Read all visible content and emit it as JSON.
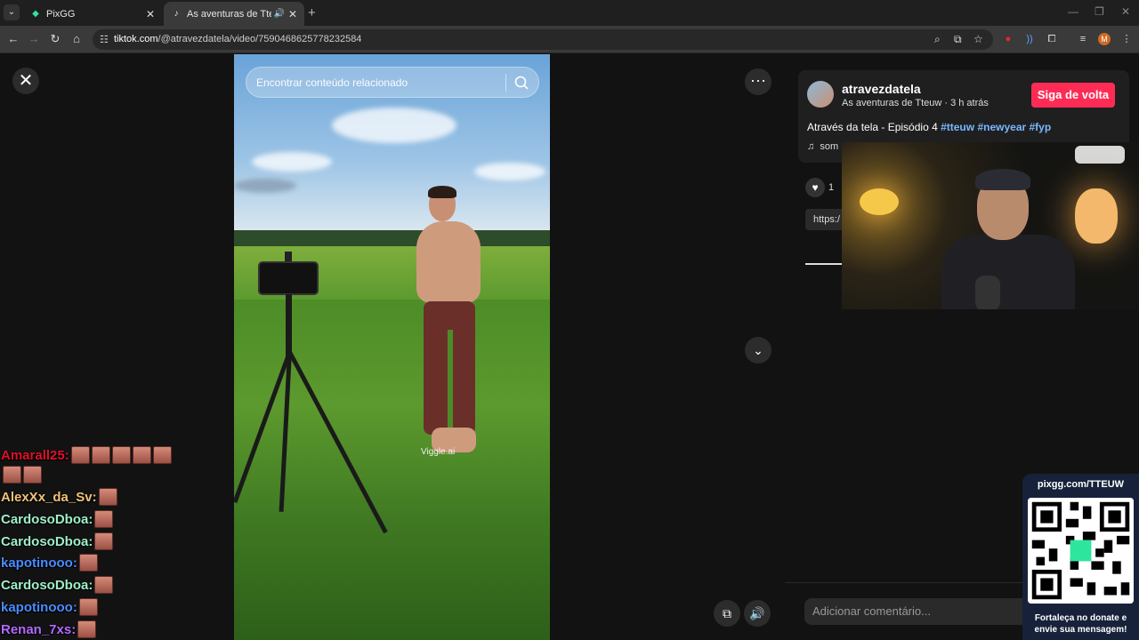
{
  "browser": {
    "tabs": [
      {
        "title": "PixGG",
        "active": false
      },
      {
        "title": "As aventuras de Tteuw (@a",
        "active": true
      }
    ],
    "url_host": "tiktok.com",
    "url_path": "/@atravezdatela/video/7590468625778232584",
    "profile_initial": "M"
  },
  "video": {
    "search_placeholder": "Encontrar conteúdo relacionado",
    "watermark": "Viggle.ai"
  },
  "post": {
    "author": "atravezdatela",
    "meta": "As aventuras de Tteuw · 3 h atrás",
    "follow_label": "Siga de volta",
    "caption_text": "Através da tela - Episódio 4 ",
    "hashtags": [
      "#tteuw",
      "#newyear",
      "#fyp"
    ],
    "sound_label": "som",
    "like_count": "1",
    "link_preview": "https:/",
    "comment_placeholder": "Adicionar comentário..."
  },
  "chat": [
    {
      "user": "Amarall25:",
      "color": "#e0102a",
      "emotes": 7
    },
    {
      "user": "AlexXx_da_Sv:",
      "color": "#f2c27a",
      "emotes": 1
    },
    {
      "user": "CardosoDboa:",
      "color": "#9ef0c8",
      "emotes": 1
    },
    {
      "user": "CardosoDboa:",
      "color": "#9ef0c8",
      "emotes": 1
    },
    {
      "user": "kapotinooo:",
      "color": "#4a8cff",
      "emotes": 1
    },
    {
      "user": "CardosoDboa:",
      "color": "#9ef0c8",
      "emotes": 1
    },
    {
      "user": "kapotinooo:",
      "color": "#4a8cff",
      "emotes": 1
    },
    {
      "user": "Renan_7xs:",
      "color": "#b26bff",
      "emotes": 1
    }
  ],
  "donate": {
    "url": "pixgg.com/TTEUW",
    "message_line1": "Fortaleça no donate e",
    "message_line2": "envie sua mensagem!"
  },
  "colors": {
    "follow_button": "#fe2c55",
    "hashtag": "#7ab8ff",
    "page_bg": "#121212"
  }
}
